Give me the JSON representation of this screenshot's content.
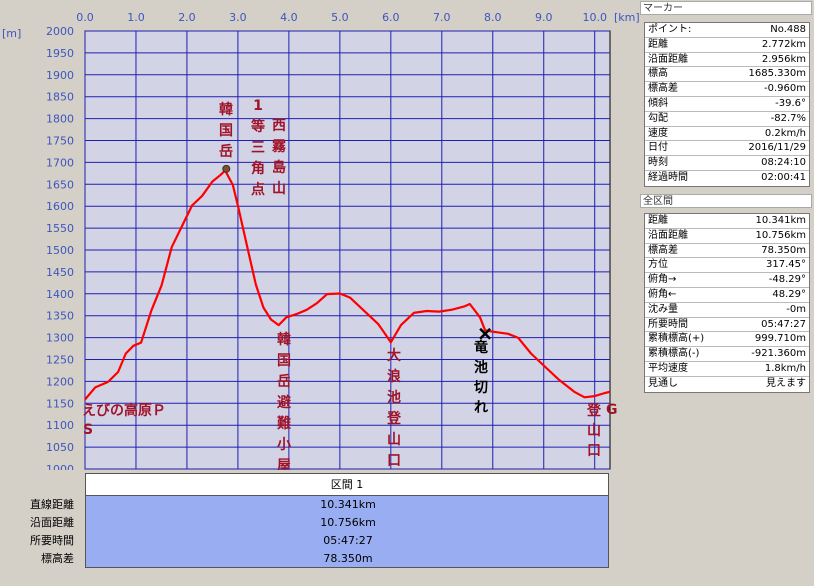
{
  "chart_data": {
    "type": "line",
    "x_unit": "[km]",
    "y_unit": "[m]",
    "xlim": [
      0,
      10.3
    ],
    "ylim": [
      1000,
      2000
    ],
    "x_ticks": [
      "0.0",
      "1.0",
      "2.0",
      "3.0",
      "4.0",
      "5.0",
      "6.0",
      "7.0",
      "8.0",
      "9.0",
      "10.0"
    ],
    "y_ticks": [
      "2000",
      "1950",
      "1900",
      "1850",
      "1800",
      "1750",
      "1700",
      "1650",
      "1600",
      "1550",
      "1500",
      "1450",
      "1400",
      "1350",
      "1300",
      "1250",
      "1200",
      "1150",
      "1100",
      "1050",
      "1000"
    ],
    "grid": true,
    "series": [
      {
        "color": "#ff0000",
        "points": [
          [
            0.0,
            1160
          ],
          [
            0.2,
            1185
          ],
          [
            0.45,
            1200
          ],
          [
            0.65,
            1220
          ],
          [
            0.8,
            1265
          ],
          [
            0.95,
            1280
          ],
          [
            1.1,
            1290
          ],
          [
            1.3,
            1360
          ],
          [
            1.5,
            1420
          ],
          [
            1.7,
            1505
          ],
          [
            1.9,
            1555
          ],
          [
            2.1,
            1600
          ],
          [
            2.3,
            1625
          ],
          [
            2.5,
            1655
          ],
          [
            2.65,
            1672
          ],
          [
            2.75,
            1680
          ],
          [
            2.9,
            1650
          ],
          [
            3.0,
            1600
          ],
          [
            3.2,
            1500
          ],
          [
            3.35,
            1420
          ],
          [
            3.5,
            1370
          ],
          [
            3.65,
            1340
          ],
          [
            3.8,
            1330
          ],
          [
            3.95,
            1345
          ],
          [
            4.15,
            1355
          ],
          [
            4.35,
            1362
          ],
          [
            4.55,
            1380
          ],
          [
            4.75,
            1398
          ],
          [
            5.0,
            1402
          ],
          [
            5.2,
            1390
          ],
          [
            5.5,
            1360
          ],
          [
            5.75,
            1330
          ],
          [
            5.9,
            1308
          ],
          [
            6.0,
            1288
          ],
          [
            6.2,
            1330
          ],
          [
            6.45,
            1355
          ],
          [
            6.7,
            1362
          ],
          [
            6.95,
            1358
          ],
          [
            7.2,
            1365
          ],
          [
            7.45,
            1370
          ],
          [
            7.55,
            1378
          ],
          [
            7.75,
            1345
          ],
          [
            7.85,
            1318
          ],
          [
            8.0,
            1312
          ],
          [
            8.3,
            1310
          ],
          [
            8.5,
            1298
          ],
          [
            8.75,
            1265
          ],
          [
            9.0,
            1235
          ],
          [
            9.3,
            1205
          ],
          [
            9.6,
            1175
          ],
          [
            9.8,
            1165
          ],
          [
            10.0,
            1165
          ],
          [
            10.2,
            1175
          ],
          [
            10.3,
            1175
          ]
        ]
      }
    ],
    "annotations": [
      {
        "text": "韓国岳",
        "x": 2.75,
        "y": 1680
      },
      {
        "text": "1等三角点",
        "x": 2.75,
        "y": 1680
      },
      {
        "text": "西霧島山",
        "x": 2.75,
        "y": 1680
      },
      {
        "text": "韓国岳避難小屋",
        "x": 3.8,
        "y": 1330
      },
      {
        "text": "大浪池登山口分岐",
        "x": 6.0,
        "y": 1288
      },
      {
        "text": "竜池切れ",
        "x": 7.85,
        "y": 1318
      },
      {
        "text": "えびの高原Ｐ",
        "x": 0.0,
        "y": 1160
      },
      {
        "text": "S",
        "x": 0.0,
        "y": 1160
      },
      {
        "text": "登山口",
        "x": 10.0,
        "y": 1165
      },
      {
        "text": "G",
        "x": 10.3,
        "y": 1175
      }
    ],
    "marker": {
      "x": 2.772,
      "y": 1685.33
    }
  },
  "marker_panel": {
    "title": "マーカー",
    "rows": [
      {
        "label": "ポイント:",
        "value": "No.488"
      },
      {
        "label": "距離",
        "value": "2.772km"
      },
      {
        "label": "沿面距離",
        "value": "2.956km"
      },
      {
        "label": "標高",
        "value": "1685.330m"
      },
      {
        "label": "標高差",
        "value": "-0.960m"
      },
      {
        "label": "傾斜",
        "value": "-39.6°"
      },
      {
        "label": "勾配",
        "value": "-82.7%"
      },
      {
        "label": "速度",
        "value": "0.2km/h"
      },
      {
        "label": "日付",
        "value": "2016/11/29"
      },
      {
        "label": "時刻",
        "value": "08:24:10"
      },
      {
        "label": "経過時間",
        "value": "02:00:41"
      }
    ]
  },
  "section_panel": {
    "title": "全区間",
    "rows": [
      {
        "label": "距離",
        "value": "10.341km"
      },
      {
        "label": "沿面距離",
        "value": "10.756km"
      },
      {
        "label": "標高差",
        "value": "78.350m"
      },
      {
        "label": "方位",
        "value": "317.45°"
      },
      {
        "label": "俯角→",
        "value": "-48.29°"
      },
      {
        "label": "俯角←",
        "value": "48.29°"
      },
      {
        "label": "沈み量",
        "value": "-0m"
      },
      {
        "label": "所要時間",
        "value": "05:47:27"
      },
      {
        "label": "累積標高(+)",
        "value": "999.710m"
      },
      {
        "label": "累積標高(-)",
        "value": "-921.360m"
      },
      {
        "label": "平均速度",
        "value": "1.8km/h"
      },
      {
        "label": "見通し",
        "value": "見えます"
      }
    ]
  },
  "summary": {
    "title": "区間 1",
    "rows": [
      {
        "label": "直線距離",
        "value": "10.341km"
      },
      {
        "label": "沿面距離",
        "value": "10.756km"
      },
      {
        "label": "所要時間",
        "value": "05:47:27"
      },
      {
        "label": "標高差",
        "value": "78.350m"
      }
    ]
  },
  "colors": {
    "plot_bg": "#d3d3e6",
    "grid": "#1f1fb0",
    "axis_text": "#3d55c0",
    "line": "#ff0000",
    "annotation_red": "#a0142a",
    "annotation_black": "#000000",
    "summary_bg": "#99adf2"
  }
}
